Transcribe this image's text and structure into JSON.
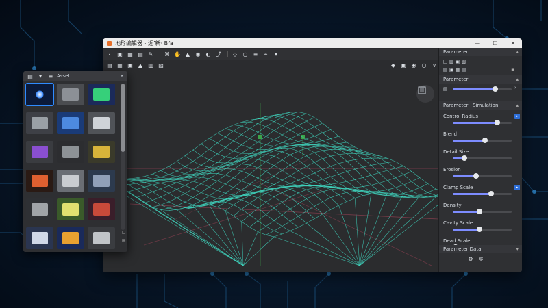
{
  "window": {
    "title": "地形编辑器 - 近’新· Bfa",
    "controls": [
      "—",
      "☐",
      "✕"
    ]
  },
  "toolbar_top": {
    "icons": [
      "back-icon",
      "select-icon",
      "transform-icon",
      "grid-icon",
      "brush-icon",
      "zoom-icon",
      "hand-icon",
      "mesh-icon",
      "camera-icon",
      "light-icon",
      "path-icon",
      "shape-icon",
      "circle-icon",
      "align-icon",
      "snap-icon",
      "dropdown-icon"
    ],
    "glyphs": [
      "‹",
      "▣",
      "▦",
      "▤",
      "✎",
      "⌘",
      "✋",
      "▲",
      "◉",
      "◐",
      "⤴",
      "◇",
      "○",
      "≡",
      "⌖",
      "▾"
    ]
  },
  "toolbar_second": {
    "glyphs": [
      "▤",
      "▦",
      "▣",
      "▲",
      "▥",
      "▨"
    ]
  },
  "viewport_tools": [
    "◆",
    "▣",
    "◉",
    "○",
    "∨"
  ],
  "properties": {
    "header": "Parameter",
    "row1": "□ ▥ ▣ ▨",
    "row2": "▤ ▣ ▦ ▤",
    "section1": "Parameter",
    "slider_label_a": "▤",
    "section2": "Parameter · Simulation",
    "rows": [
      {
        "label": "Control Radius",
        "value": 0.75
      },
      {
        "label": "Blend",
        "value": 0.55
      },
      {
        "label": "Detail Size",
        "value": 0.2
      },
      {
        "label": "Erosion",
        "value": 0.4
      },
      {
        "label": "Clamp Scale",
        "value": 0.65
      },
      {
        "label": "Density",
        "value": 0.45
      },
      {
        "label": "Cavity Scale",
        "value": 0.45
      },
      {
        "label": "Dead Scale",
        "value": 0
      }
    ],
    "section3": "Parameter Data"
  },
  "asset_panel": {
    "title": "Asset",
    "close": "✕",
    "side_glyphs": [
      "□",
      "▤"
    ]
  },
  "bottom_bar": {
    "glyphs": [
      "⤴",
      "□",
      "▣",
      "▦",
      "◉"
    ]
  },
  "colors": {
    "accent": "#2f6fd8",
    "terrain": "#3fd4bd",
    "grid": "#a8455a",
    "gizmo": "#3ca34a"
  }
}
